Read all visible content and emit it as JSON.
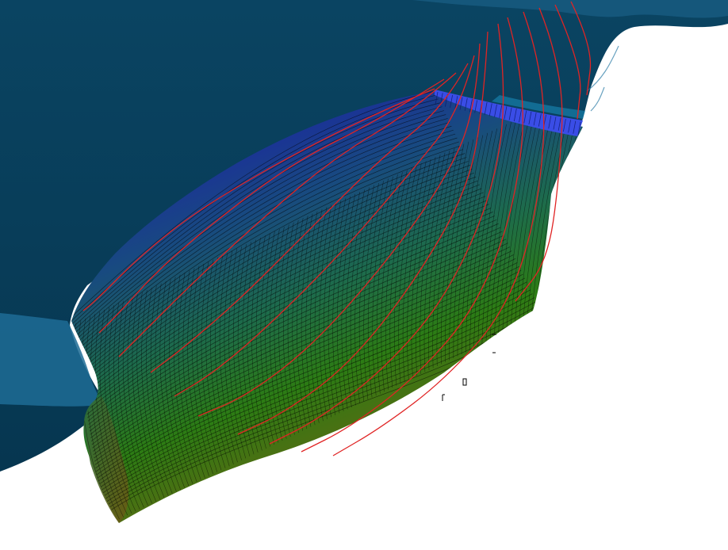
{
  "scene": {
    "colors": {
      "background": "#ffffff",
      "water_surface": "#073c57",
      "water_highlight": "#1d6c95",
      "wetted_band": "#3045e0",
      "hull_top": "#1f2aa4",
      "hull_mid_blue": "#14507a",
      "hull_green": "#2f7d14",
      "hull_bottom": "#6b5a12",
      "mesh_lines": "#000000",
      "streamlines": "#e02424"
    },
    "layers": [
      "water-surface",
      "hull-surface",
      "hull-mesh",
      "wetted-band",
      "streamlines",
      "stray-marks"
    ]
  }
}
